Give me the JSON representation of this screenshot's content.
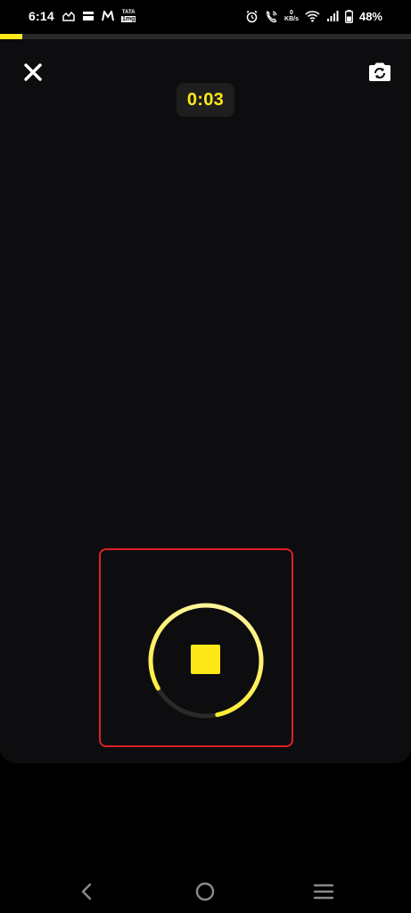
{
  "status_bar": {
    "time": "6:14",
    "left_icons": [
      "chart-app-icon",
      "card-app-icon",
      "myntra-icon",
      "tata-1mg-icon"
    ],
    "tata_label_top": "TATA",
    "tata_label_bottom": "1mg",
    "right_icons": [
      "alarm-icon",
      "wifi-call-icon",
      "net-speed",
      "wifi-icon",
      "signal-icon",
      "battery-icon"
    ],
    "net_speed_value": "0",
    "net_speed_unit": "KB/s",
    "battery_percent": "48%"
  },
  "recording": {
    "progress_fraction": 0.055,
    "timer": "0:03",
    "ring_progress_fraction": 0.8
  },
  "colors": {
    "accent": "#ffe81a",
    "highlight": "#e01f2a",
    "camera_bg": "#0d0d0f"
  },
  "controls": {
    "close": "close-icon",
    "flip_camera": "flip-camera-icon",
    "stop": "stop-icon"
  },
  "nav_bar": {
    "items": [
      "back-icon",
      "home-icon",
      "menu-icon"
    ]
  }
}
